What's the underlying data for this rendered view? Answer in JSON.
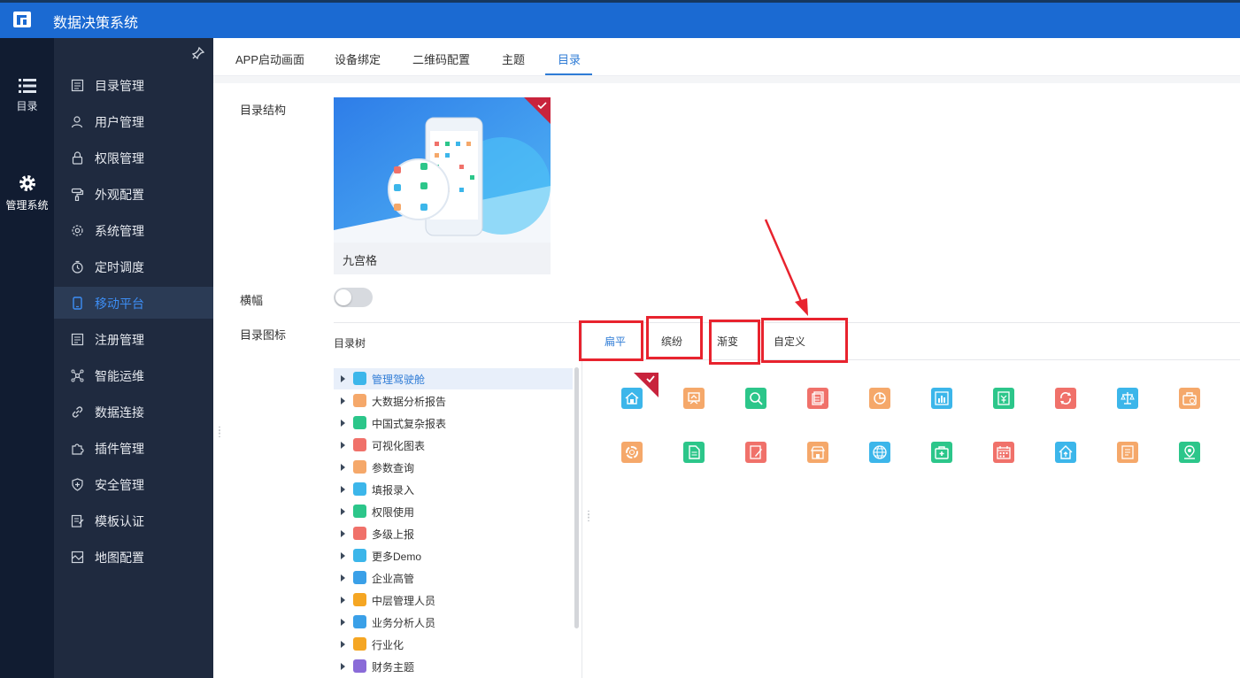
{
  "header": {
    "title": "数据决策系统"
  },
  "rail": [
    {
      "label": "目录",
      "icon": "list-icon"
    },
    {
      "label": "管理系统",
      "icon": "gear-icon"
    }
  ],
  "menu": {
    "items": [
      {
        "label": "目录管理",
        "icon": "catalog-icon",
        "active": false
      },
      {
        "label": "用户管理",
        "icon": "user-icon",
        "active": false
      },
      {
        "label": "权限管理",
        "icon": "lock-icon",
        "active": false
      },
      {
        "label": "外观配置",
        "icon": "paint-roller-icon",
        "active": false
      },
      {
        "label": "系统管理",
        "icon": "settings-icon",
        "active": false
      },
      {
        "label": "定时调度",
        "icon": "timer-icon",
        "active": false
      },
      {
        "label": "移动平台",
        "icon": "mobile-icon",
        "active": true
      },
      {
        "label": "注册管理",
        "icon": "register-icon",
        "active": false
      },
      {
        "label": "智能运维",
        "icon": "network-icon",
        "active": false
      },
      {
        "label": "数据连接",
        "icon": "link-icon",
        "active": false
      },
      {
        "label": "插件管理",
        "icon": "plugin-icon",
        "active": false
      },
      {
        "label": "安全管理",
        "icon": "shield-icon",
        "active": false
      },
      {
        "label": "模板认证",
        "icon": "template-icon",
        "active": false
      },
      {
        "label": "地图配置",
        "icon": "map-icon",
        "active": false
      }
    ]
  },
  "tabs": [
    {
      "label": "APP启动画面",
      "active": false
    },
    {
      "label": "设备绑定",
      "active": false
    },
    {
      "label": "二维码配置",
      "active": false
    },
    {
      "label": "主题",
      "active": false
    },
    {
      "label": "目录",
      "active": true
    }
  ],
  "form": {
    "structure_label": "目录结构",
    "structure_caption": "九宫格",
    "banner_label": "横幅",
    "banner_on": false,
    "icon_label": "目录图标"
  },
  "tree": {
    "title": "目录树",
    "items": [
      {
        "label": "管理驾驶舱",
        "color": "#3cb6ea",
        "selected": true
      },
      {
        "label": "大数据分析报告",
        "color": "#f5a86a",
        "selected": false
      },
      {
        "label": "中国式复杂报表",
        "color": "#2cc68a",
        "selected": false
      },
      {
        "label": "可视化图表",
        "color": "#f0716a",
        "selected": false
      },
      {
        "label": "参数查询",
        "color": "#f5a86a",
        "selected": false
      },
      {
        "label": "填报录入",
        "color": "#3cb6ea",
        "selected": false
      },
      {
        "label": "权限使用",
        "color": "#2cc68a",
        "selected": false
      },
      {
        "label": "多级上报",
        "color": "#f0716a",
        "selected": false
      },
      {
        "label": "更多Demo",
        "color": "#3cb6ea",
        "selected": false
      },
      {
        "label": "企业高管",
        "color": "#3aa0e8",
        "selected": false
      },
      {
        "label": "中层管理人员",
        "color": "#f5a623",
        "selected": false
      },
      {
        "label": "业务分析人员",
        "color": "#3aa0e8",
        "selected": false
      },
      {
        "label": "行业化",
        "color": "#f5a623",
        "selected": false
      },
      {
        "label": "财务主题",
        "color": "#8a6bd8",
        "selected": false
      }
    ]
  },
  "style_tabs": [
    {
      "label": "扁平",
      "active": true
    },
    {
      "label": "缤纷",
      "active": false
    },
    {
      "label": "渐变",
      "active": false
    },
    {
      "label": "自定义",
      "active": false
    }
  ],
  "icon_grid": [
    {
      "icon": "home-icon",
      "color": "#3cb6ea",
      "selected": true
    },
    {
      "icon": "board-icon",
      "color": "#f5a86a",
      "selected": false
    },
    {
      "icon": "search-icon",
      "color": "#2cc68a",
      "selected": false
    },
    {
      "icon": "docs-icon",
      "color": "#f0716a",
      "selected": false
    },
    {
      "icon": "pie-icon",
      "color": "#f5a86a",
      "selected": false
    },
    {
      "icon": "bar-chart-icon",
      "color": "#3cb6ea",
      "selected": false
    },
    {
      "icon": "yen-doc-icon",
      "color": "#2cc68a",
      "selected": false
    },
    {
      "icon": "refresh-icon",
      "color": "#f0716a",
      "selected": false
    },
    {
      "icon": "scale-icon",
      "color": "#3cb6ea",
      "selected": false
    },
    {
      "icon": "bag-icon",
      "color": "#f5a86a",
      "selected": false
    },
    {
      "icon": "ring-icon",
      "color": "#f5a86a",
      "selected": false
    },
    {
      "icon": "file-icon",
      "color": "#2cc68a",
      "selected": false
    },
    {
      "icon": "edit-doc-icon",
      "color": "#f0716a",
      "selected": false
    },
    {
      "icon": "store-icon",
      "color": "#f5a86a",
      "selected": false
    },
    {
      "icon": "globe-icon",
      "color": "#3cb6ea",
      "selected": false
    },
    {
      "icon": "medkit-icon",
      "color": "#2cc68a",
      "selected": false
    },
    {
      "icon": "calendar-icon",
      "color": "#f0716a",
      "selected": false
    },
    {
      "icon": "house-up-icon",
      "color": "#3cb6ea",
      "selected": false
    },
    {
      "icon": "list-doc-icon",
      "color": "#f5a86a",
      "selected": false
    },
    {
      "icon": "user-pin-icon",
      "color": "#2cc68a",
      "selected": false
    }
  ],
  "colors": {
    "header": "#1b6ad2",
    "rail": "#111c31",
    "menu": "#1f2a3f",
    "accent": "#2f7cd6",
    "annotation": "#e8232e"
  }
}
